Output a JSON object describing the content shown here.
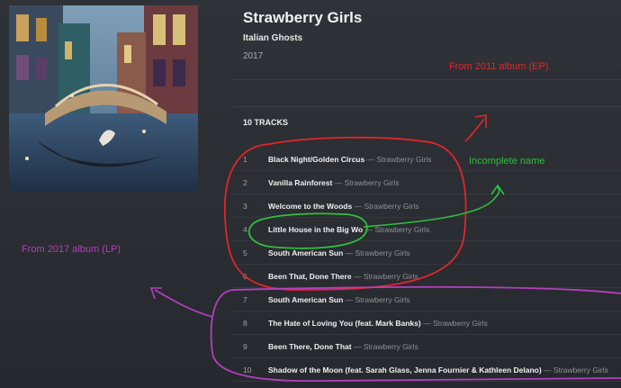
{
  "album": {
    "title": "Strawberry Girls",
    "artist": "Italian Ghosts",
    "year": "2017",
    "track_count": "10 TRACKS"
  },
  "tracks": [
    {
      "num": "1",
      "title": "Black Night/Golden Circus",
      "sep": " — ",
      "artist": "Strawberry Girls"
    },
    {
      "num": "2",
      "title": "Vanilla Rainforest",
      "sep": " — ",
      "artist": "Strawberry Girls"
    },
    {
      "num": "3",
      "title": "Welcome to the Woods",
      "sep": " — ",
      "artist": "Strawberry Girls"
    },
    {
      "num": "4",
      "title": "Little House in the Big Wo",
      "sep": " — ",
      "artist": "Strawberry Girls"
    },
    {
      "num": "5",
      "title": "South American Sun",
      "sep": " — ",
      "artist": "Strawberry Girls"
    },
    {
      "num": "6",
      "title": "Been That, Done There",
      "sep": " — ",
      "artist": "Strawberry Girls"
    },
    {
      "num": "7",
      "title": "South American Sun",
      "sep": " — ",
      "artist": "Strawberry Girls"
    },
    {
      "num": "8",
      "title": "The Hate of Loving You (feat. Mark Banks)",
      "sep": " — ",
      "artist": "Strawberry Girls"
    },
    {
      "num": "9",
      "title": "Been There, Done That",
      "sep": " — ",
      "artist": "Strawberry Girls"
    },
    {
      "num": "10",
      "title": "Shadow of the Moon (feat. Sarah Glass, Jenna Fournier & Kathleen Delano)",
      "sep": " — ",
      "artist": "Strawberry Girls"
    }
  ],
  "annotations": {
    "ep_note": "From 2011 album (EP)",
    "lp_note": "From 2017 album (LP)",
    "incomplete_note": "Incomplete name",
    "red": "#e0262b",
    "green": "#2fbf3f",
    "purple": "#b43fc0"
  }
}
